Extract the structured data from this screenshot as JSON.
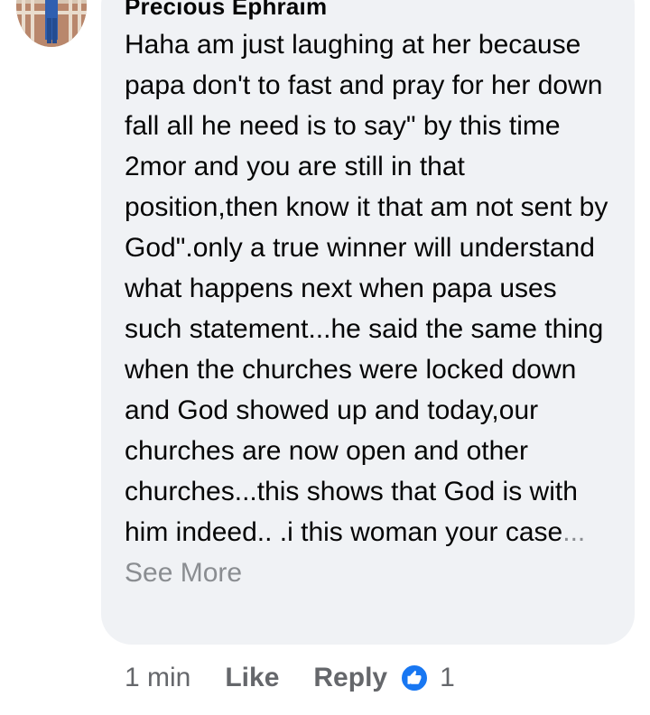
{
  "comment": {
    "author": "Precious Ephraim",
    "text": "Haha am just laughing at her because papa don't to fast and pray for her down fall all he need is to say\" by this time 2mor and you are still in that position,then know it that am not sent by God\".only a true winner will understand what happens next when papa uses such statement...he said the same thing when the churches were locked down and God showed up and today,our churches are now open and other churches...this shows that God is with him indeed.. .i this woman your case",
    "see_more_label": "... See More",
    "timestamp": "1 min",
    "like_label": "Like",
    "reply_label": "Reply",
    "reaction_icon": "thumbs-up-icon",
    "reaction_count": "1"
  },
  "colors": {
    "bubble": "#f0f2f5",
    "text": "#050505",
    "muted": "#65676b",
    "like_blue": "#1877f2"
  }
}
